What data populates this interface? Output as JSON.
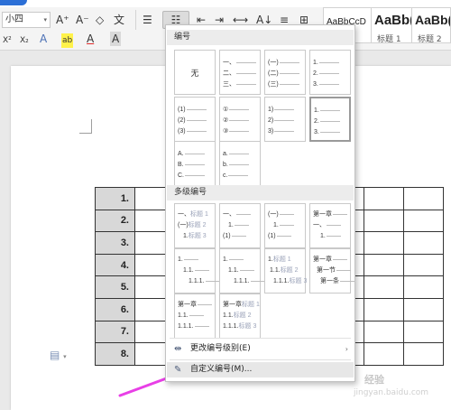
{
  "ribbon": {
    "font_size_value": "小四",
    "font_size_dropdown": "▾",
    "row1": {
      "grow_font": "A⁺",
      "shrink_font": "A⁻",
      "clear_format": "◇",
      "phonetic": "文",
      "bullets": "☰",
      "numbering": "☷",
      "decrease_indent": "⇤",
      "increase_indent": "⇥",
      "direction": "⟷",
      "sort": "A↓",
      "spacing": "≡",
      "border": "⊞"
    },
    "row2": {
      "superscript": "X²",
      "subscript": "X₂",
      "text_effect": "A",
      "highlight": "ab",
      "font_color": "A",
      "char_shading": "A"
    },
    "styles": [
      {
        "sample": "AaBbCcD",
        "caption": ""
      },
      {
        "sample": "AaBb(",
        "caption": "标题 1"
      },
      {
        "sample": "AaBb(",
        "caption": "标题 2"
      }
    ]
  },
  "dropdown": {
    "section_numbering": "编号",
    "none_label": "无",
    "numbering_cells": [
      {
        "lines": [
          "一、",
          "二、",
          "三、"
        ]
      },
      {
        "lines": [
          "(一)",
          "(二)",
          "(三)"
        ]
      },
      {
        "lines": [
          "1.",
          "2.",
          "3."
        ]
      },
      {
        "lines": [
          "(1)",
          "(2)",
          "(3)"
        ]
      },
      {
        "lines": [
          "①",
          "②",
          "③"
        ]
      },
      {
        "lines": [
          "1)",
          "2)",
          "3)"
        ]
      },
      {
        "lines": [
          "1.",
          "2.",
          "3."
        ]
      },
      {
        "lines": [
          "A.",
          "B.",
          "C."
        ]
      },
      {
        "lines": [
          "a.",
          "b.",
          "c."
        ]
      }
    ],
    "section_multilevel": "多级编号",
    "multilevel_cells": [
      {
        "lines": [
          [
            "一、",
            "标题 1"
          ],
          [
            "(一)",
            "标题 2"
          ],
          [
            "1.",
            "标题 3"
          ]
        ]
      },
      {
        "lines": [
          [
            "一、",
            ""
          ],
          [
            "1.",
            ""
          ],
          [
            "(1)",
            ""
          ]
        ]
      },
      {
        "lines": [
          [
            "(一)",
            ""
          ],
          [
            "1.",
            ""
          ],
          [
            "(1)",
            ""
          ]
        ]
      },
      {
        "lines": [
          [
            "第一章",
            ""
          ],
          [
            "一、",
            ""
          ],
          [
            "1.",
            ""
          ]
        ]
      },
      {
        "lines": [
          [
            "1.",
            ""
          ],
          [
            "1.1.",
            ""
          ],
          [
            "1.1.1.",
            ""
          ]
        ]
      },
      {
        "lines": [
          [
            "1.",
            ""
          ],
          [
            "1.1.",
            ""
          ],
          [
            "1.1.1.",
            ""
          ]
        ]
      },
      {
        "lines": [
          [
            "1.",
            "标题 1"
          ],
          [
            "1.1.",
            "标题 2"
          ],
          [
            "1.1.1.",
            "标题 3"
          ]
        ]
      },
      {
        "lines": [
          [
            "第一章",
            ""
          ],
          [
            "第一节",
            ""
          ],
          [
            "第一条",
            ""
          ]
        ]
      },
      {
        "lines": [
          [
            "第一章",
            ""
          ],
          [
            "1.1.",
            ""
          ],
          [
            "1.1.1.",
            ""
          ]
        ]
      },
      {
        "lines": [
          [
            "第一章",
            "标题 1"
          ],
          [
            "1.1.",
            "标题 2"
          ],
          [
            "1.1.1.",
            "标题 3"
          ]
        ]
      }
    ],
    "change_level": "更改编号级别(E)",
    "change_level_arrow": "›",
    "custom_numbering": "自定义编号(M)..."
  },
  "document": {
    "row_numbers": [
      "1.",
      "2.",
      "3.",
      "4.",
      "5.",
      "6.",
      "7.",
      "8."
    ]
  },
  "watermark": {
    "site_name": "经验",
    "url": "jingyan.baidu.com"
  },
  "colors": {
    "arrow": "#e83fe6",
    "row_number_fill": "#d8d8d8",
    "tab_accent": "#2b6fd6"
  }
}
